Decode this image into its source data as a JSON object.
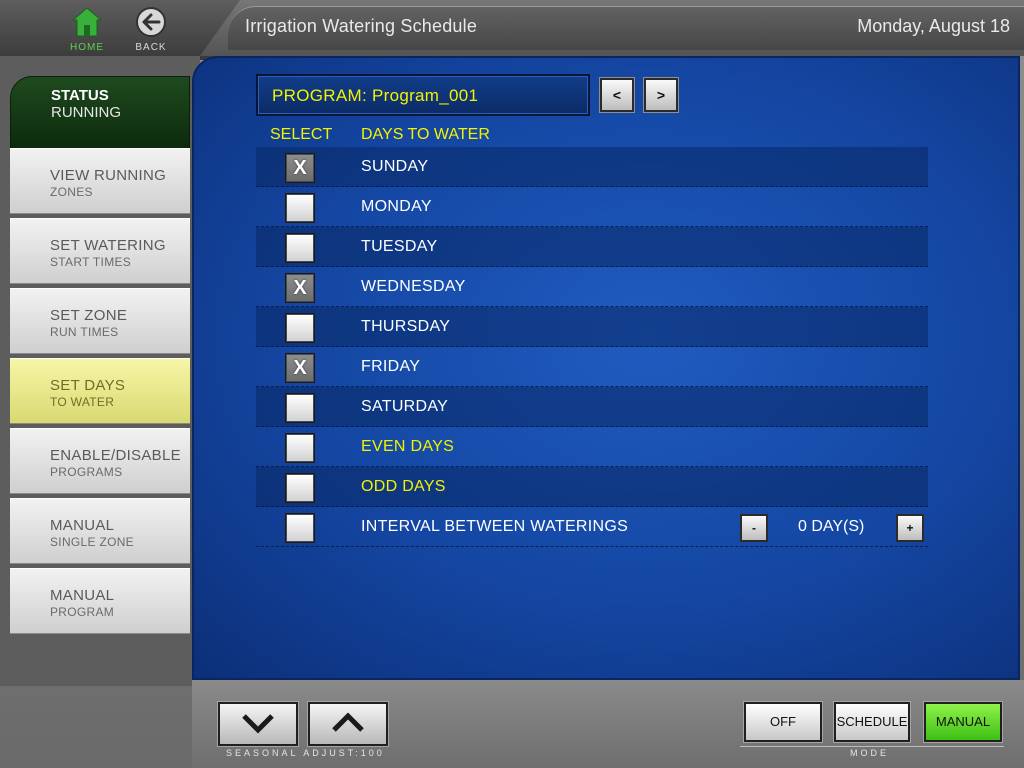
{
  "header": {
    "title": "Irrigation Watering Schedule",
    "date": "Monday, August 18",
    "home_label": "HOME",
    "back_label": "BACK"
  },
  "status": {
    "title": "STATUS",
    "value": "RUNNING"
  },
  "sidebar": {
    "items": [
      {
        "title": "VIEW RUNNING",
        "sub": "ZONES"
      },
      {
        "title": "SET WATERING",
        "sub": "START TIMES"
      },
      {
        "title": "SET ZONE",
        "sub": "RUN TIMES"
      },
      {
        "title": "SET DAYS",
        "sub": "TO WATER"
      },
      {
        "title": "ENABLE/DISABLE",
        "sub": "PROGRAMS"
      },
      {
        "title": "MANUAL",
        "sub": "SINGLE ZONE"
      },
      {
        "title": "MANUAL",
        "sub": "PROGRAM"
      }
    ],
    "active_index": 3
  },
  "program": {
    "label": "PROGRAM: Program_001",
    "prev_label": "<",
    "next_label": ">"
  },
  "columns": {
    "select": "SELECT",
    "days": "DAYS TO WATER"
  },
  "days": [
    {
      "label": "SUNDAY",
      "checked": true
    },
    {
      "label": "MONDAY",
      "checked": false
    },
    {
      "label": "TUESDAY",
      "checked": false
    },
    {
      "label": "WEDNESDAY",
      "checked": true
    },
    {
      "label": "THURSDAY",
      "checked": false
    },
    {
      "label": "FRIDAY",
      "checked": true
    },
    {
      "label": "SATURDAY",
      "checked": false
    },
    {
      "label": "EVEN DAYS",
      "checked": false
    },
    {
      "label": "ODD DAYS",
      "checked": false
    },
    {
      "label": "INTERVAL BETWEEN WATERINGS",
      "checked": false
    }
  ],
  "check_mark": "X",
  "interval": {
    "minus_label": "-",
    "plus_label": "+",
    "value": "0 DAY(S)"
  },
  "bottom": {
    "seasonal_label": "SEASONAL ADJUST:100",
    "mode_label": "MODE",
    "off_label": "OFF",
    "schedule_label": "SCHEDULE",
    "manual_label": "MANUAL"
  },
  "colors": {
    "accent_yellow": "#f3f300",
    "panel_blue": "#1446a2",
    "status_green": "#0c2a0c",
    "manual_active": "#3ebf14",
    "menu_active": "#d9d972",
    "home_green": "#5fd04a"
  },
  "icons": {
    "home": "home-icon",
    "back": "back-arrow-icon",
    "seasonal_down": "chevron-down-icon",
    "seasonal_up": "chevron-up-icon"
  }
}
